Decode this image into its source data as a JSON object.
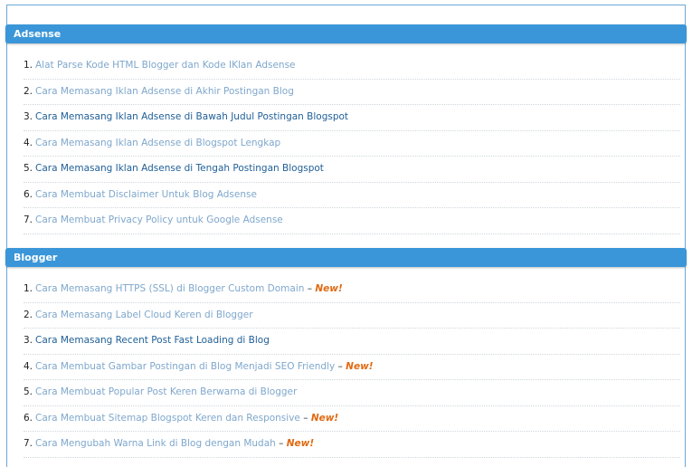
{
  "sections": [
    {
      "title": "Adsense",
      "items": [
        {
          "num": "1.",
          "text": "Alat Parse Kode HTML Blogger dan Kode IKlan Adsense",
          "style": "light",
          "badge": ""
        },
        {
          "num": "2.",
          "text": "Cara Memasang Iklan Adsense di Akhir Postingan Blog",
          "style": "light",
          "badge": ""
        },
        {
          "num": "3.",
          "text": "Cara Memasang Iklan Adsense di Bawah Judul Postingan Blogspot",
          "style": "dark",
          "badge": ""
        },
        {
          "num": "4.",
          "text": "Cara Memasang Iklan Adsense di Blogspot Lengkap",
          "style": "light",
          "badge": ""
        },
        {
          "num": "5.",
          "text": "Cara Memasang Iklan Adsense di Tengah Postingan Blogspot",
          "style": "dark",
          "badge": ""
        },
        {
          "num": "6.",
          "text": "Cara Membuat Disclaimer Untuk Blog Adsense",
          "style": "light",
          "badge": ""
        },
        {
          "num": "7.",
          "text": "Cara Membuat Privacy Policy untuk Google Adsense",
          "style": "light",
          "badge": ""
        }
      ]
    },
    {
      "title": "Blogger",
      "items": [
        {
          "num": "1.",
          "text": "Cara Memasang HTTPS (SSL) di Blogger Custom Domain",
          "style": "light",
          "badge": "New!"
        },
        {
          "num": "2.",
          "text": "Cara Memasang Label Cloud Keren di Blogger",
          "style": "light",
          "badge": ""
        },
        {
          "num": "3.",
          "text": "Cara Memasang Recent Post Fast Loading di Blog",
          "style": "dark",
          "badge": ""
        },
        {
          "num": "4.",
          "text": "Cara Membuat Gambar Postingan di Blog Menjadi SEO Friendly",
          "style": "light",
          "badge": "New!"
        },
        {
          "num": "5.",
          "text": "Cara Membuat Popular Post Keren Berwarna di Blogger",
          "style": "light",
          "badge": ""
        },
        {
          "num": "6.",
          "text": "Cara Membuat Sitemap Blogspot Keren dan Responsive",
          "style": "light",
          "badge": "New!"
        },
        {
          "num": "7.",
          "text": "Cara Mengubah Warna Link di Blog dengan Mudah",
          "style": "light",
          "badge": "New!"
        }
      ]
    }
  ],
  "separator": "–",
  "colors": {
    "header": "#3a96d8",
    "link_visited": "#7fa7cc",
    "link": "#1f5f97",
    "badge": "#e06a12"
  }
}
